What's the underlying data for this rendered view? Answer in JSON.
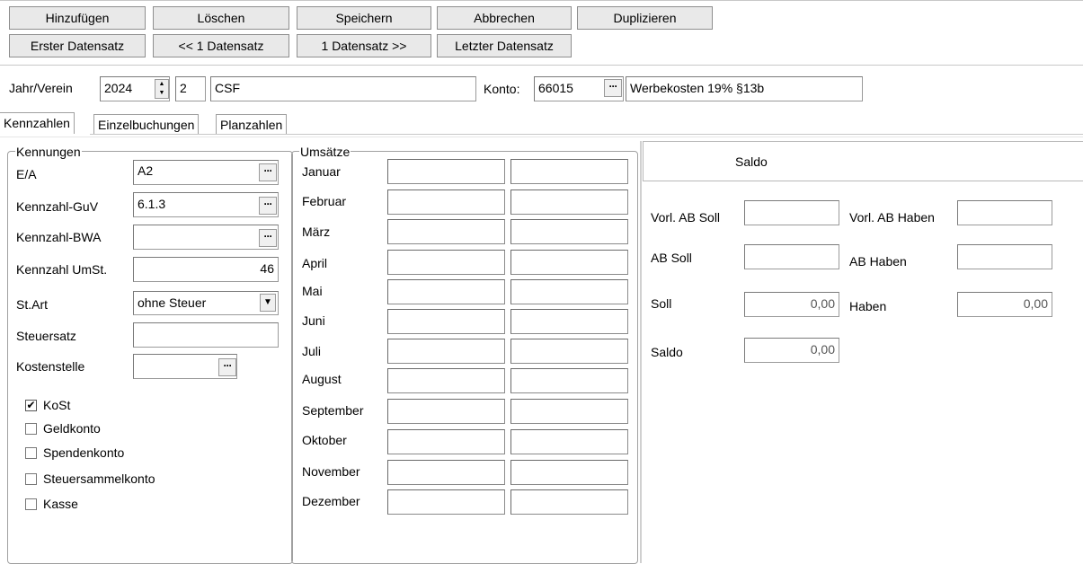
{
  "toolbar": {
    "row1": [
      "Hinzufügen",
      "Löschen",
      "Speichern",
      "Abbrechen",
      "Duplizieren"
    ],
    "row2": [
      "Erster Datensatz",
      "<< 1 Datensatz",
      "1 Datensatz >>",
      "Letzter Datensatz"
    ]
  },
  "header": {
    "jahr_label": "Jahr/Verein",
    "jahr_value": "2024",
    "verein_value": "2",
    "verein_name": "CSF",
    "konto_label": "Konto:",
    "konto_value": "66015",
    "konto_name": "Werbekosten 19% §13b"
  },
  "tabs": [
    "Kennzahlen",
    "Einzelbuchungen",
    "Planzahlen"
  ],
  "kennungen": {
    "title": "Kennungen",
    "ea_label": "E/A",
    "ea_value": "A2",
    "guv_label": "Kennzahl-GuV",
    "guv_value": "6.1.3",
    "bwa_label": "Kennzahl-BWA",
    "bwa_value": "",
    "ust_label": "Kennzahl UmSt.",
    "ust_value": "46",
    "start_label": "St.Art",
    "start_value": "ohne Steuer",
    "steuersatz_label": "Steuersatz",
    "steuersatz_value": "",
    "kostenstelle_label": "Kostenstelle",
    "kostenstelle_value": "",
    "checkboxes": [
      {
        "label": "KoSt",
        "checked": true,
        "mark": "✔"
      },
      {
        "label": "Geldkonto",
        "checked": false,
        "mark": ""
      },
      {
        "label": "Spendenkonto",
        "checked": false,
        "mark": ""
      },
      {
        "label": "Steuersammelkonto",
        "checked": false,
        "mark": ""
      },
      {
        "label": "Kasse",
        "checked": false,
        "mark": ""
      }
    ]
  },
  "umsaetze": {
    "title": "Umsätze",
    "months": [
      "Januar",
      "Februar",
      "März",
      "April",
      "Mai",
      "Juni",
      "Juli",
      "August",
      "September",
      "Oktober",
      "November",
      "Dezember"
    ]
  },
  "saldo": {
    "header": "Saldo",
    "vorl_ab_soll_label": "Vorl. AB Soll",
    "vorl_ab_soll_value": "",
    "vorl_ab_haben_label": "Vorl. AB Haben",
    "vorl_ab_haben_value": "",
    "ab_soll_label": "AB Soll",
    "ab_soll_value": "",
    "ab_haben_label": "AB Haben",
    "ab_haben_value": "",
    "soll_label": "Soll",
    "soll_value": "0,00",
    "haben_label": "Haben",
    "haben_value": "0,00",
    "saldo_label": "Saldo",
    "saldo_value": "0,00"
  }
}
